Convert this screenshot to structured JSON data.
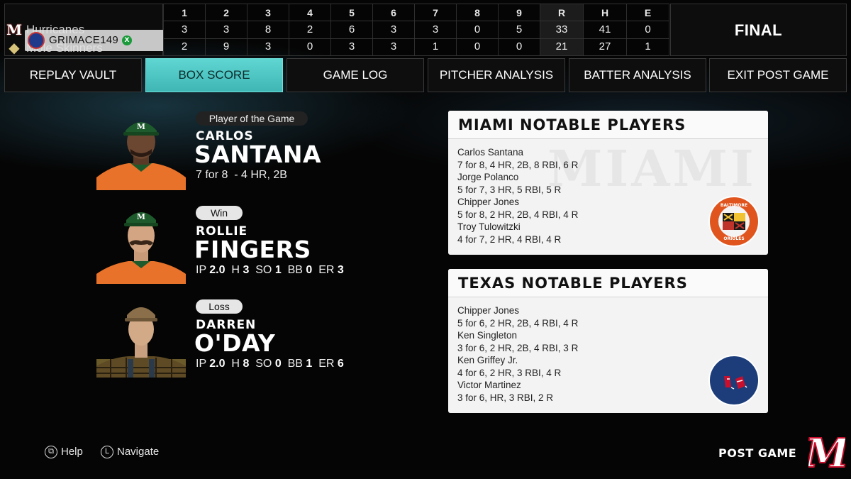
{
  "scoreboard": {
    "teams": [
      {
        "name": "Hurricanes",
        "innings": [
          "3",
          "3",
          "8",
          "2",
          "6",
          "3",
          "3",
          "0",
          "5"
        ],
        "r": "33",
        "h": "41",
        "e": "0"
      },
      {
        "name": "Mole Skinners",
        "innings": [
          "2",
          "9",
          "3",
          "0",
          "3",
          "3",
          "1",
          "0",
          "0"
        ],
        "r": "21",
        "h": "27",
        "e": "1"
      }
    ],
    "inning_headers": [
      "1",
      "2",
      "3",
      "4",
      "5",
      "6",
      "7",
      "8",
      "9"
    ],
    "r_header": "R",
    "h_header": "H",
    "e_header": "E",
    "gamertag": "GRIMACE149",
    "status": "FINAL"
  },
  "tabs": [
    {
      "label": "REPLAY VAULT",
      "active": false
    },
    {
      "label": "BOX SCORE",
      "active": true
    },
    {
      "label": "GAME LOG",
      "active": false
    },
    {
      "label": "PITCHER ANALYSIS",
      "active": false
    },
    {
      "label": "BATTER ANALYSIS",
      "active": false
    },
    {
      "label": "EXIT POST GAME",
      "active": false
    }
  ],
  "potg": {
    "badge": "Player of the Game",
    "first": "CARLOS",
    "last": "SANTANA",
    "stats": "7 for 8  - 4 HR, 2B"
  },
  "win": {
    "badge": "Win",
    "first": "ROLLIE",
    "last": "FINGERS",
    "ip_label": "IP",
    "ip": "2.0",
    "h_label": "H",
    "h": "3",
    "so_label": "SO",
    "so": "1",
    "bb_label": "BB",
    "bb": "0",
    "er_label": "ER",
    "er": "3"
  },
  "loss": {
    "badge": "Loss",
    "first": "DARREN",
    "last": "O'DAY",
    "ip_label": "IP",
    "ip": "2.0",
    "h_label": "H",
    "h": "8",
    "so_label": "SO",
    "so": "0",
    "bb_label": "BB",
    "bb": "1",
    "er_label": "ER",
    "er": "6"
  },
  "miami": {
    "title": "MIAMI NOTABLE PLAYERS",
    "lines": [
      "Carlos Santana",
      "7 for 8, 4 HR, 2B, 8 RBI, 6 R",
      "Jorge Polanco",
      "5 for 7, 3 HR, 5 RBI, 5 R",
      "Chipper Jones",
      "5 for 8, 2 HR, 2B, 4 RBI, 4 R",
      "Troy Tulowitzki",
      "4 for 7, 2 HR, 4 RBI, 4 R"
    ],
    "watermark": "MIAMI",
    "logo_text_top": "BALTIMORE",
    "logo_text_bottom": "ORIOLES"
  },
  "texas": {
    "title": "TEXAS NOTABLE PLAYERS",
    "lines": [
      "Chipper Jones",
      "5 for 6, 2 HR, 2B, 4 RBI, 4 R",
      "Ken Singleton",
      "3 for 6, 2 HR, 2B, 4 RBI, 3 R",
      "Ken Griffey Jr.",
      "4 for 6, 2 HR, 3 RBI, 4 R",
      "Victor Martinez",
      "3 for 6, HR, 3 RBI, 2 R"
    ]
  },
  "footer": {
    "help": "Help",
    "navigate": "Navigate",
    "navigate_key": "L",
    "postgame": "POST GAME"
  },
  "colors": {
    "accent": "#4fc8c6",
    "orange": "#e8722a",
    "green": "#1d5a2c",
    "orioles": "#e0551e",
    "redsox_blue": "#1c3d7a"
  }
}
